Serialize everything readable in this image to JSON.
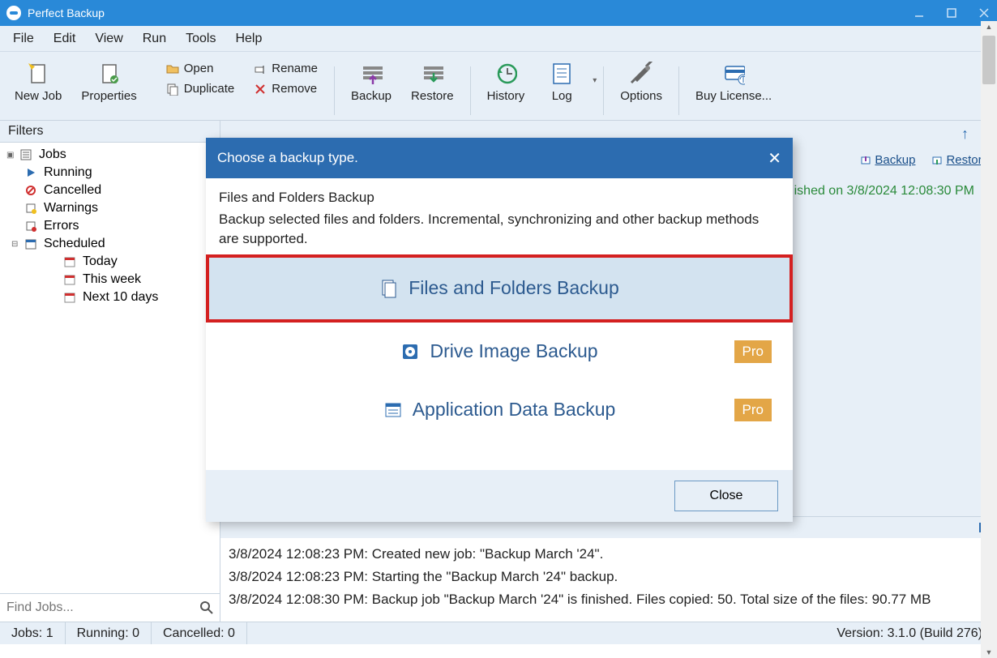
{
  "app": {
    "title": "Perfect Backup"
  },
  "menu": [
    "File",
    "Edit",
    "View",
    "Run",
    "Tools",
    "Help"
  ],
  "toolbar": {
    "newjob": "New Job",
    "properties": "Properties",
    "open": "Open",
    "duplicate": "Duplicate",
    "rename": "Rename",
    "remove": "Remove",
    "backup": "Backup",
    "restore": "Restore",
    "history": "History",
    "log": "Log",
    "options": "Options",
    "buy": "Buy License..."
  },
  "sidebar": {
    "header": "Filters",
    "root": "Jobs",
    "items": [
      "Running",
      "Cancelled",
      "Warnings",
      "Errors"
    ],
    "scheduled": "Scheduled",
    "schedItems": [
      "Today",
      "This week",
      "Next 10 days"
    ],
    "searchPlaceholder": "Find Jobs..."
  },
  "jobrow": {
    "backup": "Backup",
    "restore": "Restore",
    "status": "ished on 3/8/2024 12:08:30 PM"
  },
  "modal": {
    "title": "Choose a backup type.",
    "descTitle": "Files and Folders Backup",
    "descBody": "Backup selected files and folders. Incremental, synchronizing and other backup methods are supported.",
    "opt1": "Files and Folders Backup",
    "opt2": "Drive Image Backup",
    "opt3": "Application Data Backup",
    "pro": "Pro",
    "close": "Close"
  },
  "log": {
    "lines": [
      "3/8/2024 12:08:23 PM: Created new job: \"Backup March '24\".",
      "3/8/2024 12:08:23 PM: Starting the \"Backup March '24\" backup.",
      "3/8/2024 12:08:30 PM: Backup job \"Backup March '24\" is finished. Files copied: 50. Total size of the files: 90.77 MB"
    ]
  },
  "status": {
    "jobs": "Jobs: 1",
    "running": "Running: 0",
    "cancelled": "Cancelled: 0",
    "version": "Version: 3.1.0 (Build 276)"
  }
}
